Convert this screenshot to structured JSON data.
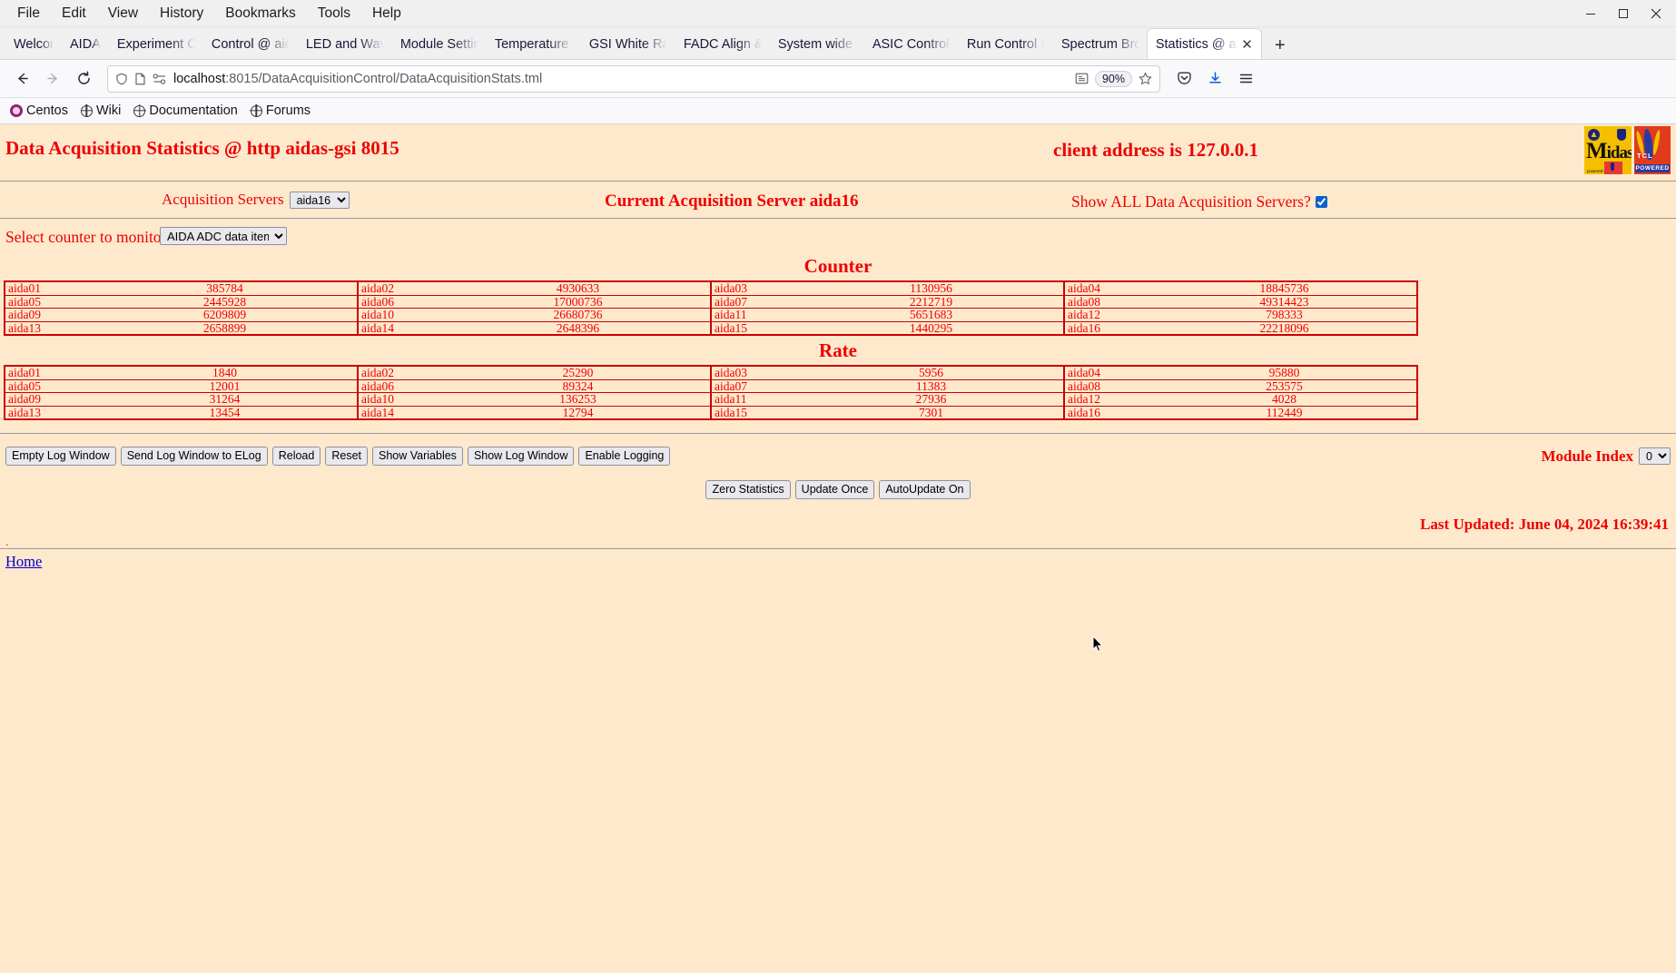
{
  "browser": {
    "menus": [
      "File",
      "Edit",
      "View",
      "History",
      "Bookmarks",
      "Tools",
      "Help"
    ],
    "window_controls": {
      "minimize": "minimize-icon",
      "maximize": "maximize-icon",
      "close": "close-icon"
    },
    "tabs": [
      {
        "label": "Welcome to Cen",
        "active": false
      },
      {
        "label": "AIDA",
        "active": false,
        "narrow": true
      },
      {
        "label": "Experiment Cont",
        "active": false
      },
      {
        "label": "Control @ aidas-",
        "active": false
      },
      {
        "label": "LED and Wavefo",
        "active": false
      },
      {
        "label": "Module Settings",
        "active": false
      },
      {
        "label": "Temperature and",
        "active": false
      },
      {
        "label": "GSI White Rabbi",
        "active": false
      },
      {
        "label": "FADC Align & Co",
        "active": false
      },
      {
        "label": "System wide Che",
        "active": false
      },
      {
        "label": "ASIC Control @ a",
        "active": false
      },
      {
        "label": "Run Control @ ai",
        "active": false
      },
      {
        "label": "Spectrum Brows",
        "active": false
      },
      {
        "label": "Statistics @ aid",
        "active": true
      }
    ],
    "new_tab_label": "+",
    "url_host": "localhost",
    "url_path": ":8015/DataAcquisitionControl/DataAcquisitionStats.tml",
    "zoom_level": "90%",
    "bookmarks": [
      "Centos",
      "Wiki",
      "Documentation",
      "Forums"
    ]
  },
  "page": {
    "title": "Data Acquisition Statistics @ http aidas-gsi 8015",
    "client_address": "client address is 127.0.0.1",
    "logo": {
      "word_cap": "M",
      "word_rest": "idas",
      "powered_by": "powered by",
      "tcl": "TCL",
      "tcl_powered": "POWERED"
    },
    "acquisition_servers_label": "Acquisition Servers",
    "acquisition_servers_value": "aida16",
    "acquisition_servers_options": [
      "aida16"
    ],
    "current_server": "Current Acquisition Server aida16",
    "show_all_label": "Show ALL Data Acquisition Servers?",
    "show_all_checked": true,
    "select_counter_label": "Select counter to monitor",
    "select_counter_value": "AIDA ADC data items",
    "select_counter_options": [
      "AIDA ADC data items"
    ],
    "counter_title": "Counter",
    "rate_title": "Rate",
    "counter_rows": [
      [
        {
          "name": "aida01",
          "value": "385784"
        },
        {
          "name": "aida02",
          "value": "4930633"
        },
        {
          "name": "aida03",
          "value": "1130956"
        },
        {
          "name": "aida04",
          "value": "18845736"
        }
      ],
      [
        {
          "name": "aida05",
          "value": "2445928"
        },
        {
          "name": "aida06",
          "value": "17000736"
        },
        {
          "name": "aida07",
          "value": "2212719"
        },
        {
          "name": "aida08",
          "value": "49314423"
        }
      ],
      [
        {
          "name": "aida09",
          "value": "6209809"
        },
        {
          "name": "aida10",
          "value": "26680736"
        },
        {
          "name": "aida11",
          "value": "5651683"
        },
        {
          "name": "aida12",
          "value": "798333"
        }
      ],
      [
        {
          "name": "aida13",
          "value": "2658899"
        },
        {
          "name": "aida14",
          "value": "2648396"
        },
        {
          "name": "aida15",
          "value": "1440295"
        },
        {
          "name": "aida16",
          "value": "22218096"
        }
      ]
    ],
    "rate_rows": [
      [
        {
          "name": "aida01",
          "value": "1840"
        },
        {
          "name": "aida02",
          "value": "25290"
        },
        {
          "name": "aida03",
          "value": "5956"
        },
        {
          "name": "aida04",
          "value": "95880"
        }
      ],
      [
        {
          "name": "aida05",
          "value": "12001"
        },
        {
          "name": "aida06",
          "value": "89324"
        },
        {
          "name": "aida07",
          "value": "11383"
        },
        {
          "name": "aida08",
          "value": "253575"
        }
      ],
      [
        {
          "name": "aida09",
          "value": "31264"
        },
        {
          "name": "aida10",
          "value": "136253"
        },
        {
          "name": "aida11",
          "value": "27936"
        },
        {
          "name": "aida12",
          "value": "4028"
        }
      ],
      [
        {
          "name": "aida13",
          "value": "13454"
        },
        {
          "name": "aida14",
          "value": "12794"
        },
        {
          "name": "aida15",
          "value": "7301"
        },
        {
          "name": "aida16",
          "value": "112449"
        }
      ]
    ],
    "buttons_left": [
      "Empty Log Window",
      "Send Log Window to ELog",
      "Reload",
      "Reset",
      "Show Variables",
      "Show Log Window",
      "Enable Logging"
    ],
    "module_index_label": "Module Index",
    "module_index_value": "0",
    "module_index_options": [
      "0"
    ],
    "buttons_mid": [
      "Zero Statistics",
      "Update Once",
      "AutoUpdate On"
    ],
    "last_updated": "Last Updated: June 04, 2024 16:39:41",
    "dot": ".",
    "home_link": "Home"
  },
  "colors": {
    "page_bg": "#ffe9cd",
    "accent_red": "#ee0000",
    "table_border": "#cc0000",
    "link_blue": "#0000cc"
  }
}
